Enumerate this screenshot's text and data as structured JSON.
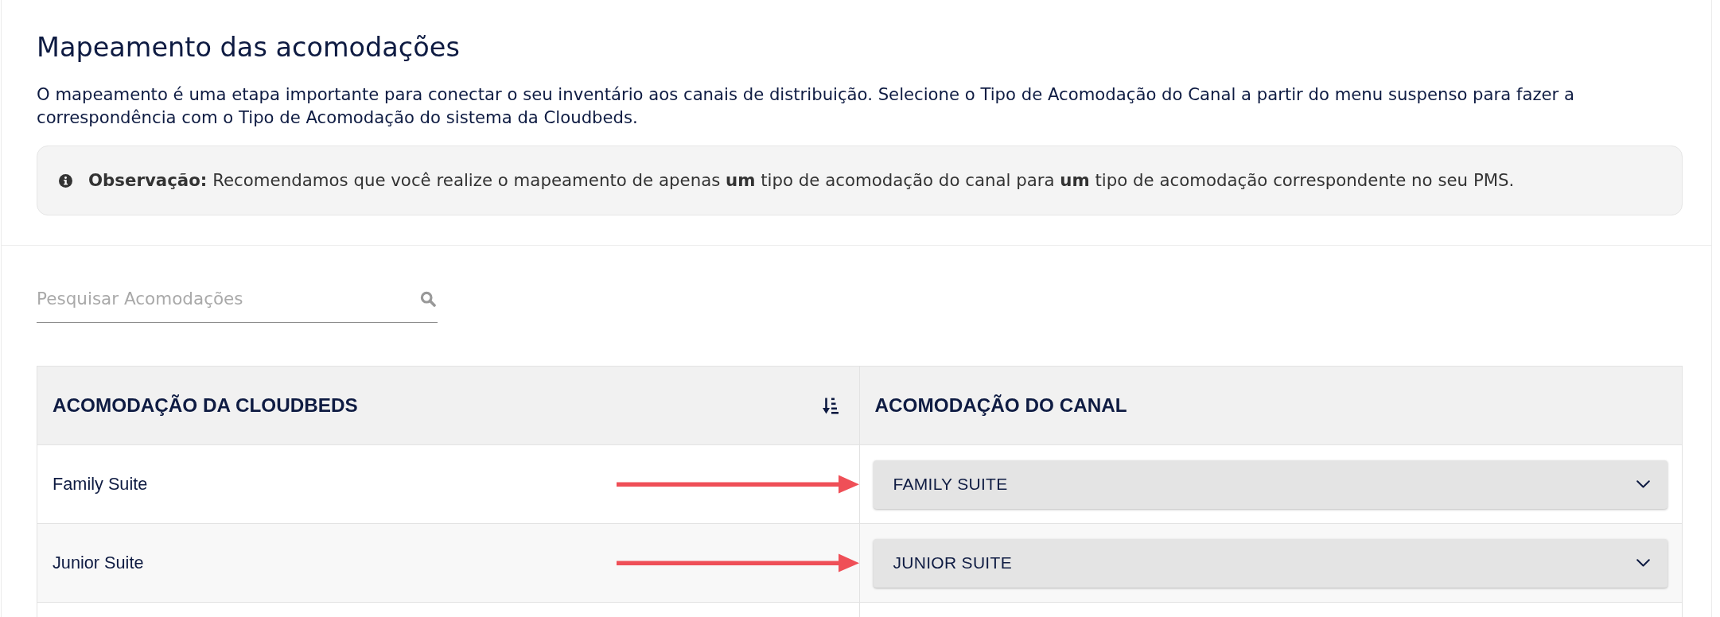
{
  "page": {
    "title": "Mapeamento das acomodações",
    "description": "O mapeamento é uma etapa importante para conectar o seu inventário aos canais de distribuição. Selecione o Tipo de Acomodação do Canal a partir do menu suspenso para fazer a correspondência com o Tipo de Acomodação do sistema da Cloudbeds.",
    "note": "**Observação:** Recomendamos que você realize o mapeamento de apenas **um** tipo de acomodação do canal para **um** tipo de acomodação correspondente no seu PMS."
  },
  "search": {
    "placeholder": "Pesquisar Acomodações"
  },
  "table": {
    "columns": [
      {
        "label": "ACOMODAÇÃO DA CLOUDBEDS",
        "sorted": true
      },
      {
        "label": "ACOMODAÇÃO DO CANAL",
        "sorted": false
      }
    ],
    "rows": [
      {
        "name": "Family Suite",
        "channel_room": "FAMILY SUITE",
        "annotated": true
      },
      {
        "name": "Junior Suite",
        "channel_room": "JUNIOR SUITE",
        "annotated": true
      }
    ]
  }
}
